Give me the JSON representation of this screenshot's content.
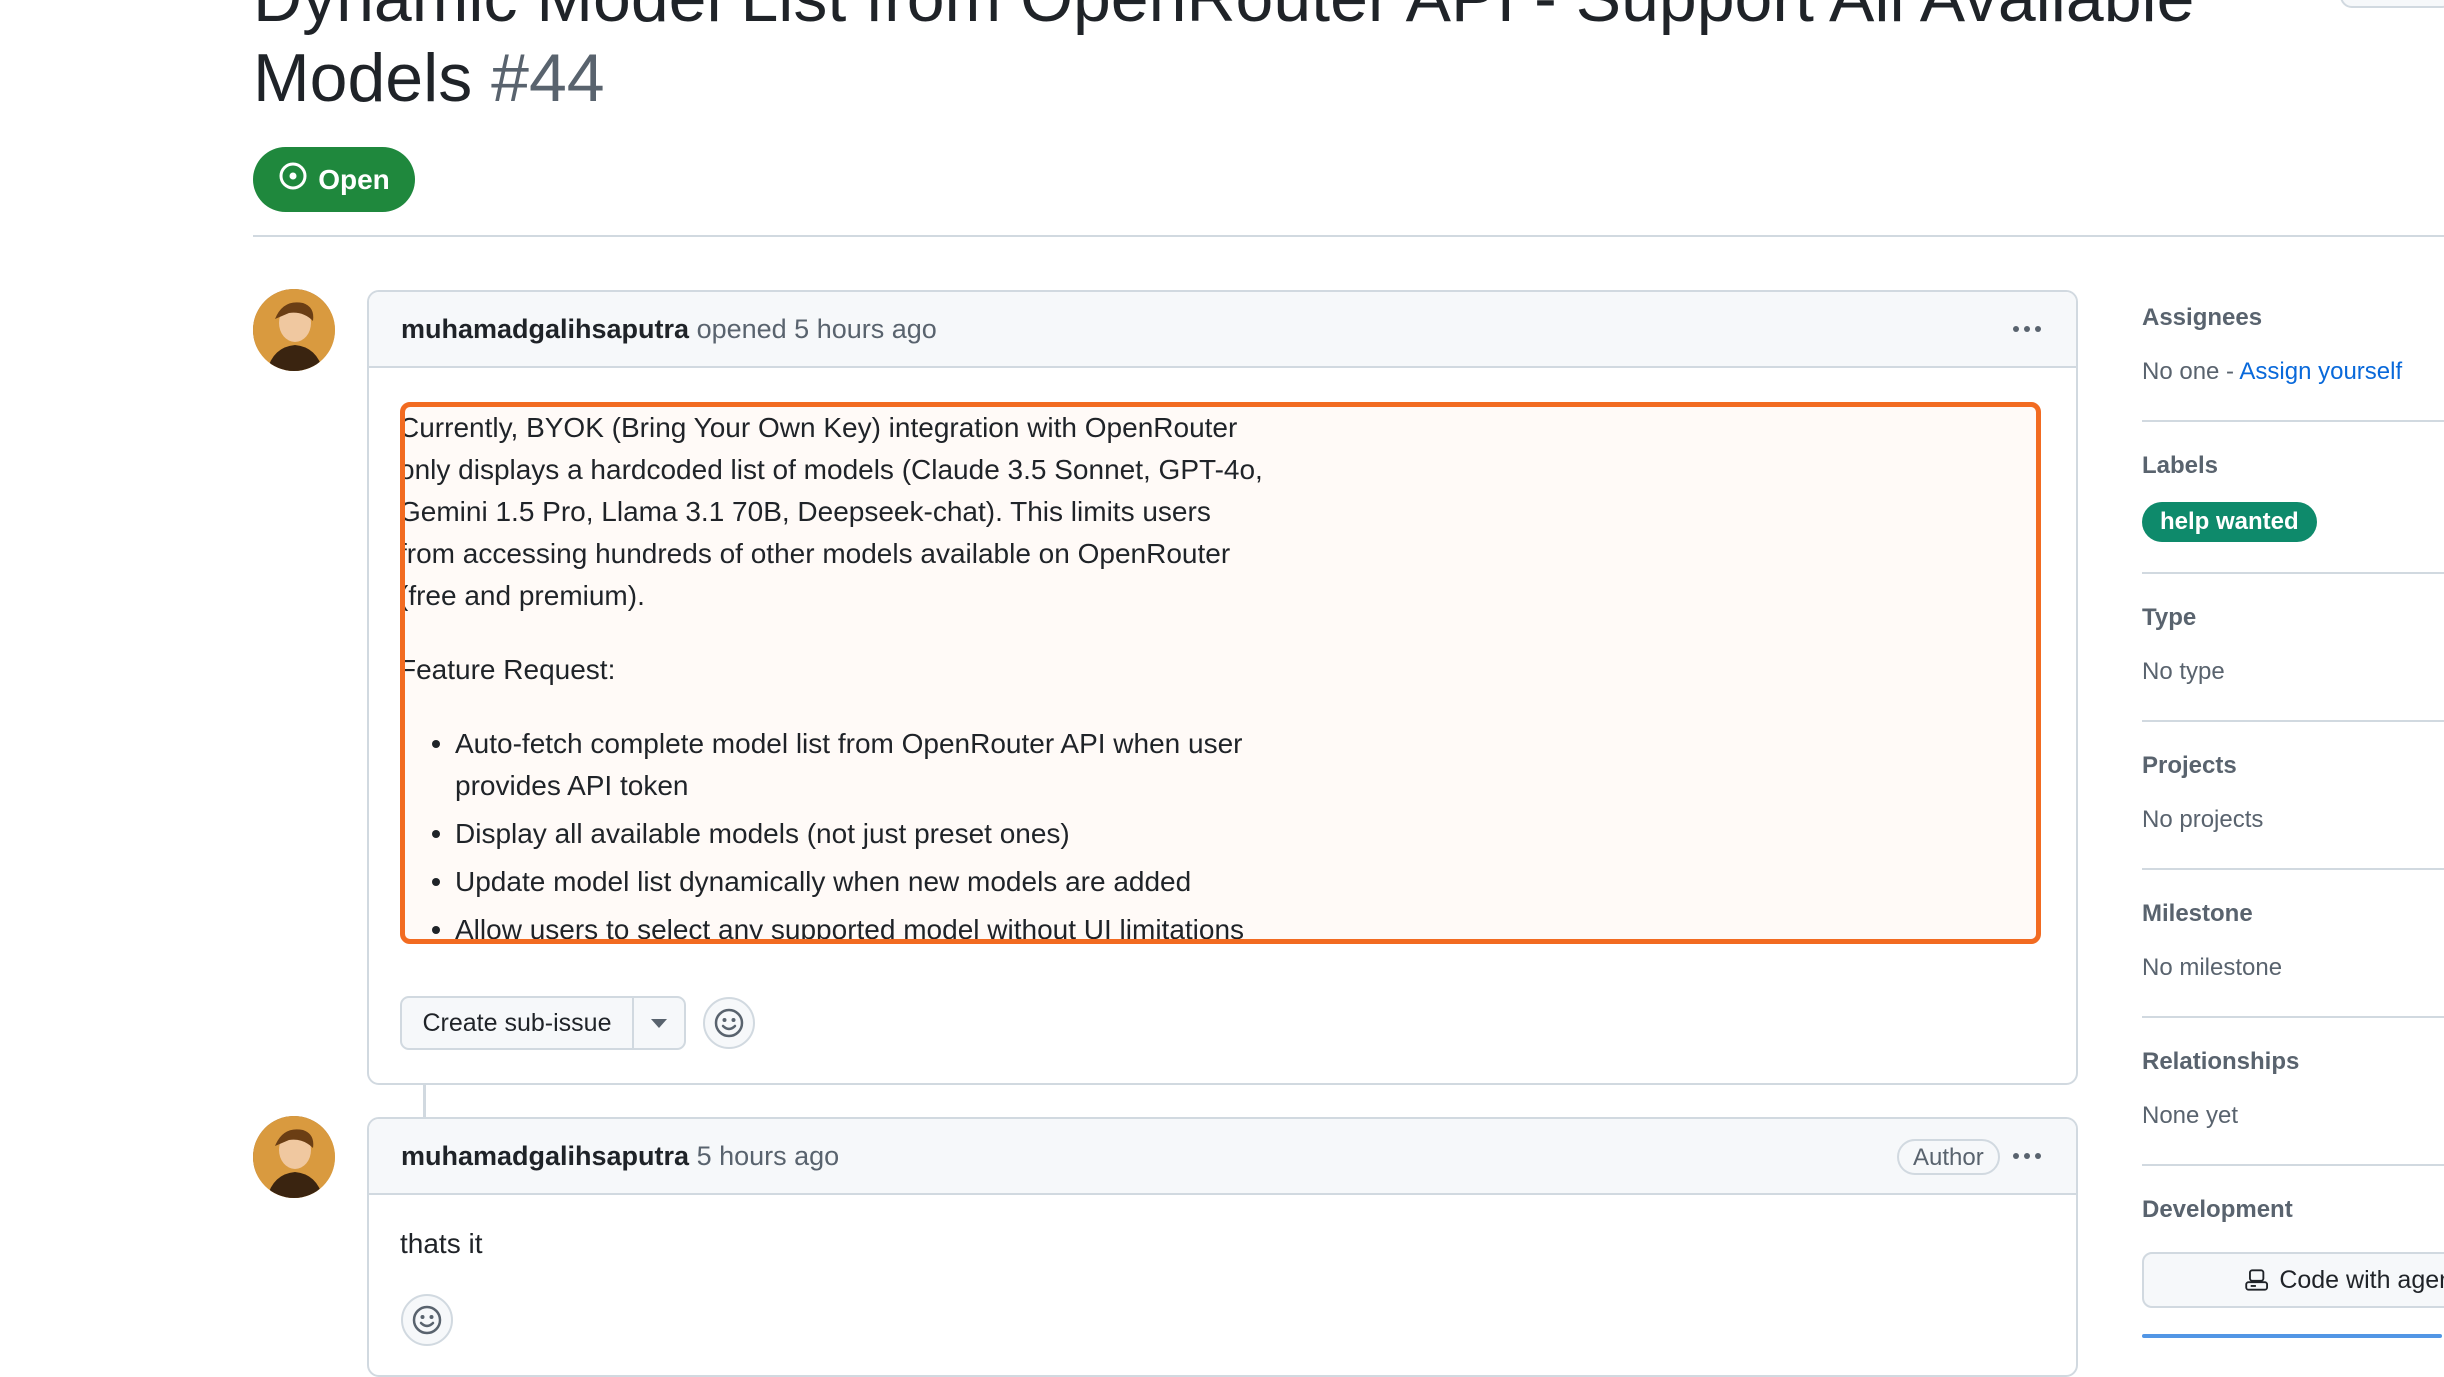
{
  "issue": {
    "title_line1": "Dynamic Model List from OpenRouter API - Support All Available",
    "title_line2": "Models",
    "number": "#44",
    "state": "Open"
  },
  "comment1": {
    "author": "muhamadgalihsaputra",
    "action": "opened 5 hours ago",
    "body_paragraphs": [
      "Currently, BYOK (Bring Your Own Key) integration with OpenRouter",
      "only displays a hardcoded list of models (Claude 3.5 Sonnet, GPT-4o,",
      "Gemini 1.5 Pro, Llama 3.1 70B, Deepseek-chat). This limits users",
      "from accessing hundreds of other models available on OpenRouter",
      "(free and premium)."
    ],
    "feature_heading": "Feature Request:",
    "bullets": [
      "Auto-fetch complete model list from OpenRouter API when user provides API token",
      "Display all available models (not just preset ones)",
      "Update model list dynamically when new models are added",
      "Allow users to select any supported model without UI limitations"
    ],
    "create_subissue_label": "Create sub-issue"
  },
  "comment2": {
    "author": "muhamadgalihsaputra",
    "time": "5 hours ago",
    "badge": "Author",
    "body": "thats it"
  },
  "sidebar": {
    "assignees_heading": "Assignees",
    "assignees_value": "No one - ",
    "assign_yourself": "Assign yourself",
    "labels_heading": "Labels",
    "label": "help wanted",
    "type_heading": "Type",
    "type_value": "No type",
    "projects_heading": "Projects",
    "projects_value": "No projects",
    "milestone_heading": "Milestone",
    "milestone_value": "No milestone",
    "relationships_heading": "Relationships",
    "relationships_value": "None yet",
    "development_heading": "Development",
    "code_button": "Code with agent"
  },
  "colors": {
    "open_green": "#1f883d",
    "highlight_orange": "#f26b21",
    "label_green": "#0e8a6b",
    "link_blue": "#0969da"
  }
}
